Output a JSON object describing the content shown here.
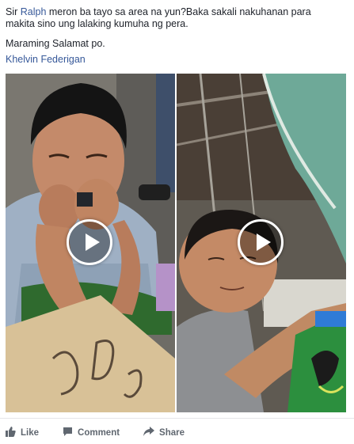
{
  "post": {
    "text_line1_pre": "Sir ",
    "text_mention": "Ralph",
    "text_line1_post": " meron ba tayo sa area na yun?Baka sakali nakuhanan para",
    "text_line2": "makita sino ung lalaking kumuha ng pera.",
    "paragraph2": "Maraming Salamat po.",
    "tagged_name": "Khelvin Federigan"
  },
  "videos": [
    {
      "id": "left",
      "content": "boy with hands over mouth sitting beside cardboard sign"
    },
    {
      "id": "right",
      "content": "boy looking up under green awning"
    }
  ],
  "actions": {
    "like": "Like",
    "comment": "Comment",
    "share": "Share"
  },
  "colors": {
    "link": "#365899",
    "text": "#1d2129",
    "action_text": "#606770"
  }
}
